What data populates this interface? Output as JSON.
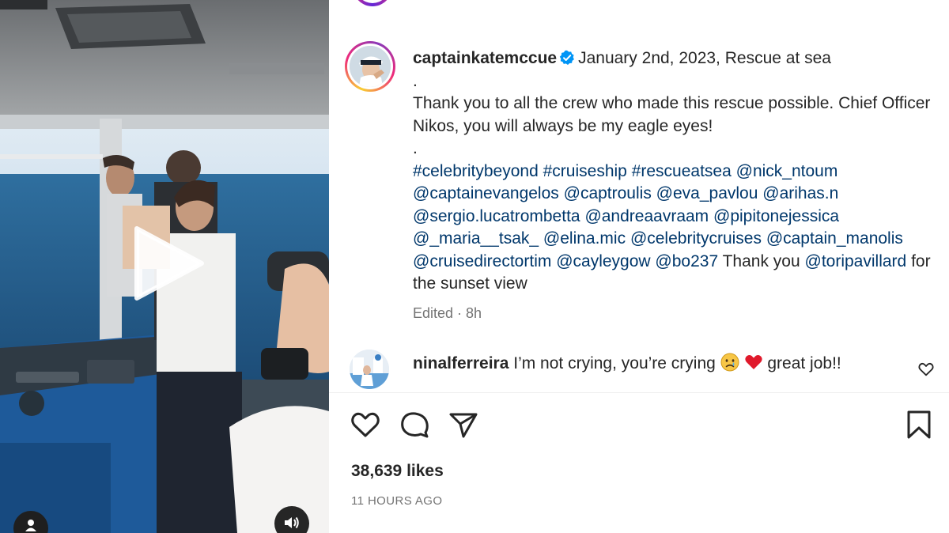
{
  "post": {
    "username": "captainkatemccue",
    "caption_title": "January 2nd, 2023, Rescue at sea",
    "dot1": ".",
    "caption_text": "Thank you to all the crew who made this rescue possible. Chief Officer Nikos, you will always be my eagle eyes!",
    "dot2": ".",
    "hashtags": [
      "#celebritybeyond",
      "#cruiseship",
      "#rescueatsea"
    ],
    "mentions": [
      "@nick_ntoum",
      "@captainevangelos",
      "@captroulis",
      "@eva_pavlou",
      "@arihas.n",
      "@sergio.lucatrombetta",
      "@andreaavraam",
      "@pipitonejessica",
      "@_maria__tsak_",
      "@elina.mic",
      "@celebritycruises",
      "@captain_manolis",
      "@cruisedirectortim",
      "@cayleygow",
      "@bo237"
    ],
    "thanks_text": "Thank you",
    "last_mention": "@toripavillard",
    "closing_text": "for the sunset view",
    "edited_label": "Edited",
    "edited_sep": " · ",
    "edited_time": "8h",
    "likes": "38,639 likes",
    "time_ago": "11 HOURS AGO"
  },
  "comment": {
    "username": "ninalferreira",
    "text_before": "I’m not crying, you’re crying",
    "emojis": [
      "crying-face",
      "red-heart"
    ],
    "text_after": "great job!!"
  },
  "icons": {
    "verified": "verified-badge-icon",
    "like": "heart-icon",
    "comment": "comment-icon",
    "share": "share-icon",
    "save": "bookmark-icon",
    "play": "play-icon",
    "audio": "speaker-icon",
    "tags": "user-tag-icon"
  },
  "colors": {
    "link": "#00376b",
    "text": "#262626",
    "secondary": "#737373",
    "verified": "#0095f6"
  }
}
